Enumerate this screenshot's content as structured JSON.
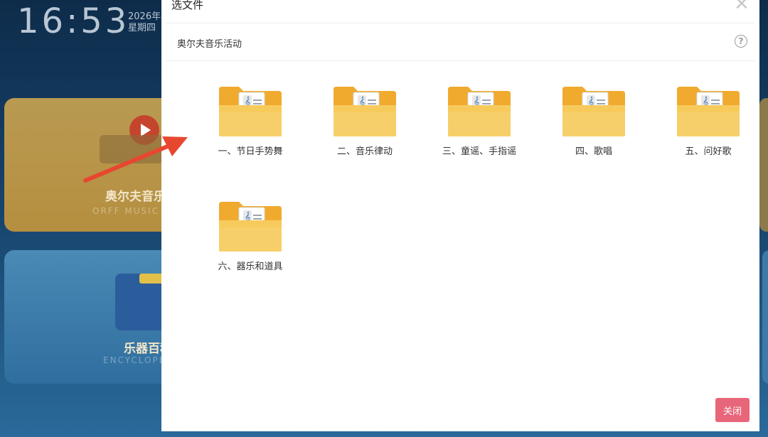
{
  "background": {
    "clock": "16:53",
    "date_line1": "2026年",
    "date_line2": "星期四",
    "cards": [
      {
        "title": "奥尔夫音乐",
        "subtitle": "ORFF MUSIC"
      },
      {
        "title": "乐器百科",
        "subtitle": "ENCYCLOPEDIA"
      }
    ]
  },
  "dialog": {
    "title": "选文件",
    "path": "奥尔夫音乐活动",
    "help_icon": "question-circle-icon",
    "close_icon": "close-x-icon",
    "folders": [
      {
        "label": "一、节日手势舞",
        "icon": "music-folder-icon"
      },
      {
        "label": "二、音乐律动",
        "icon": "music-folder-icon"
      },
      {
        "label": "三、童谣、手指谣",
        "icon": "music-folder-icon"
      },
      {
        "label": "四、歌唱",
        "icon": "music-folder-icon"
      },
      {
        "label": "五、问好歌",
        "icon": "music-folder-icon"
      },
      {
        "label": "六、器乐和道具",
        "icon": "music-folder-icon"
      }
    ],
    "close_button": "关闭"
  },
  "colors": {
    "folder": "#f5c04a",
    "folder_dark": "#f0aa2e",
    "accent_button": "#e8667a",
    "annotation_arrow": "#e8472f"
  }
}
